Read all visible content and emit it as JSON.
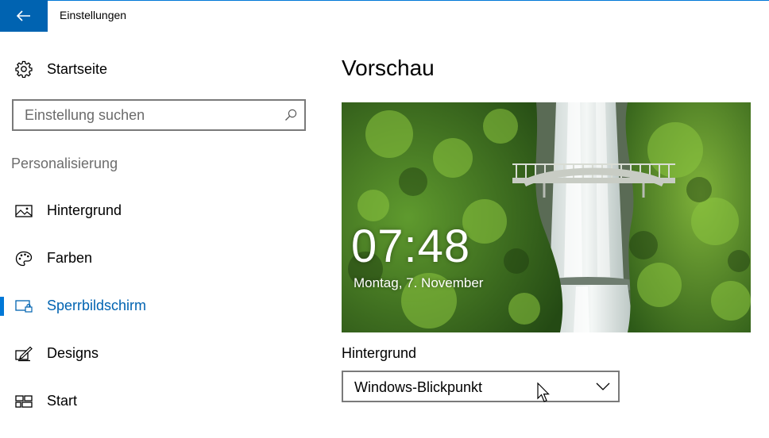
{
  "window": {
    "title": "Einstellungen"
  },
  "sidebar": {
    "home_label": "Startseite",
    "search_placeholder": "Einstellung suchen",
    "section_heading": "Personalisierung",
    "items": [
      {
        "label": "Hintergrund",
        "icon": "image-icon",
        "active": false
      },
      {
        "label": "Farben",
        "icon": "palette-icon",
        "active": false
      },
      {
        "label": "Sperrbildschirm",
        "icon": "lock-screen-icon",
        "active": true
      },
      {
        "label": "Designs",
        "icon": "designs-icon",
        "active": false
      },
      {
        "label": "Start",
        "icon": "start-tiles-icon",
        "active": false
      }
    ]
  },
  "main": {
    "title": "Vorschau",
    "preview": {
      "time": "07:48",
      "date": "Montag, 7. November"
    },
    "background_label": "Hintergrund",
    "background_value": "Windows-Blickpunkt"
  },
  "colors": {
    "accent": "#0078d7",
    "accent_dark": "#0063b1"
  }
}
